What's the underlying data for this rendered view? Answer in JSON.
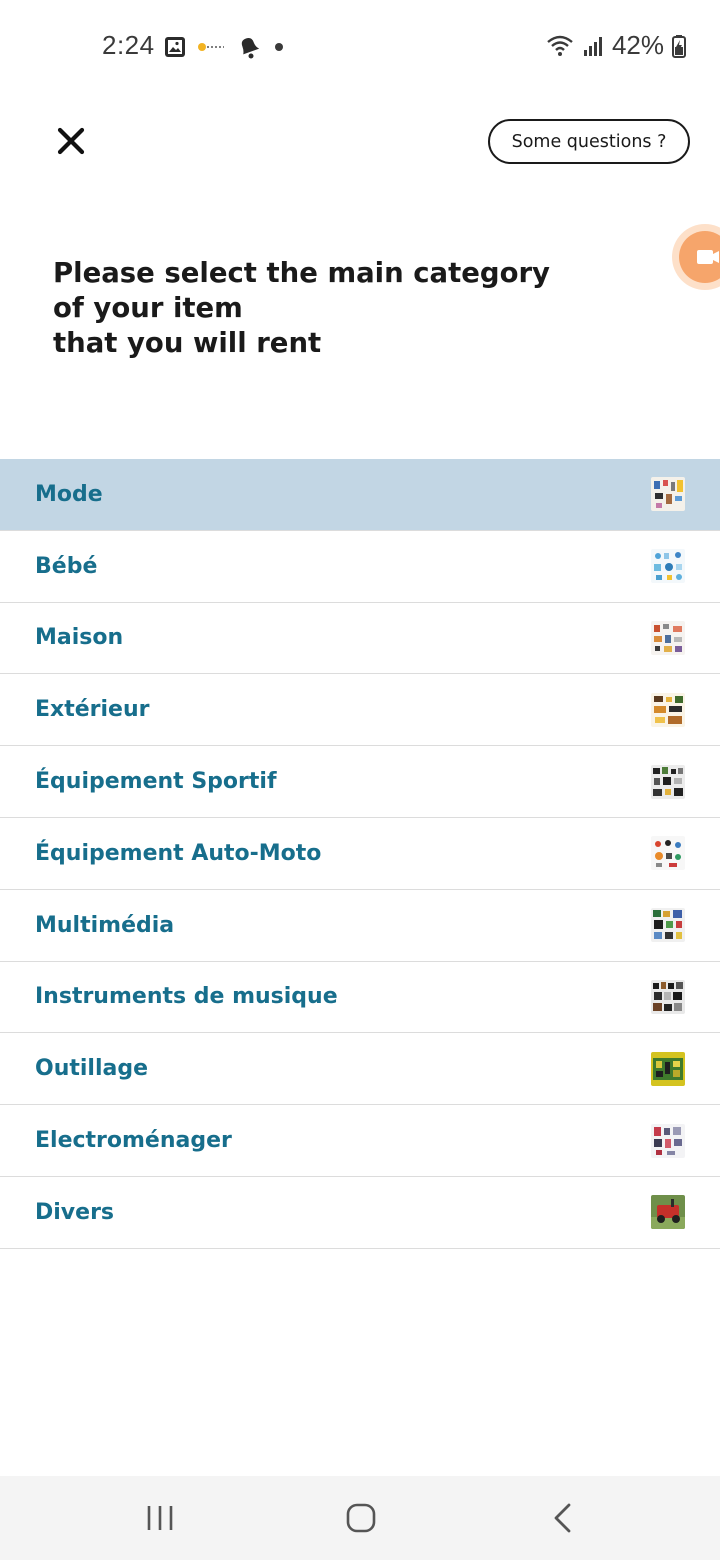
{
  "status_bar": {
    "time": "2:24",
    "battery": "42%",
    "left_icons": [
      "image-notification-icon",
      "app-notification-icon",
      "bell-icon",
      "dot-icon"
    ],
    "right_icons": [
      "wifi-icon",
      "signal-icon",
      "battery-icon"
    ]
  },
  "header": {
    "questions_label": "Some questions ?"
  },
  "title": {
    "line1": "Please select the main category",
    "line2": "of your item",
    "line3": "that you will rent"
  },
  "categories": [
    {
      "label": "Mode",
      "selected": true
    },
    {
      "label": "Bébé",
      "selected": false
    },
    {
      "label": "Maison",
      "selected": false
    },
    {
      "label": "Extérieur",
      "selected": false
    },
    {
      "label": "Équipement Sportif",
      "selected": false
    },
    {
      "label": "Équipement Auto-Moto",
      "selected": false
    },
    {
      "label": "Multimédia",
      "selected": false
    },
    {
      "label": "Instruments de musique",
      "selected": false
    },
    {
      "label": "Outillage",
      "selected": false
    },
    {
      "label": "Electroménager",
      "selected": false
    },
    {
      "label": "Divers",
      "selected": false
    }
  ],
  "colors": {
    "accent_text": "#176e8c",
    "selected_row": "#c2d6e4",
    "float_bubble": "#f6a56b"
  },
  "nav_icons": [
    "recent-apps-icon",
    "home-icon",
    "back-icon"
  ]
}
